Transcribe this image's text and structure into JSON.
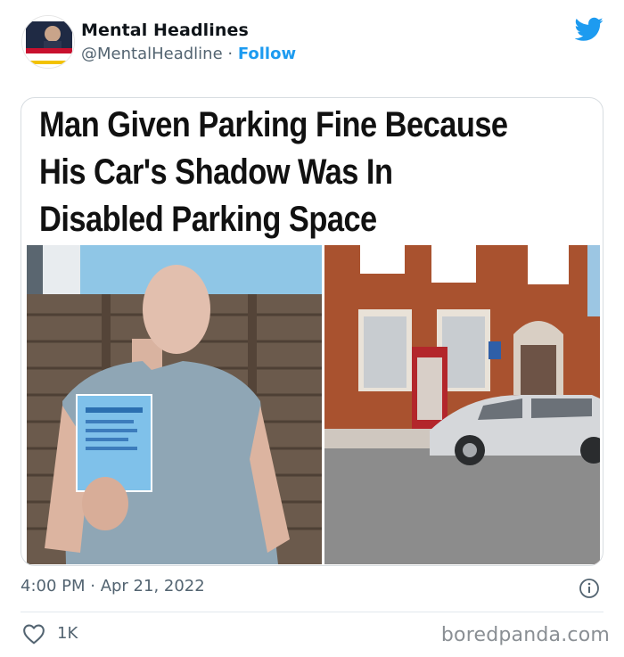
{
  "account": {
    "name": "Mental Headlines",
    "handle": "@MentalHeadline",
    "separator": " · ",
    "follow_label": "Follow",
    "avatar_banner_top": "BREAKING NEWS",
    "avatar_banner_text": "THE UK IS MENTAL"
  },
  "post": {
    "headline_lines": [
      "Man Given Parking Fine Because",
      "His Car's Shadow Was In",
      "Disabled Parking Space"
    ],
    "timestamp": "4:00 PM · Apr 21, 2022"
  },
  "engagement": {
    "likes": "1K"
  },
  "watermark": "boredpanda.com",
  "colors": {
    "twitter_blue": "#1d9bf0",
    "muted_text": "#536471",
    "headline": "#111111"
  },
  "icons": [
    "twitter-bird-icon",
    "info-icon",
    "heart-outline-icon"
  ]
}
